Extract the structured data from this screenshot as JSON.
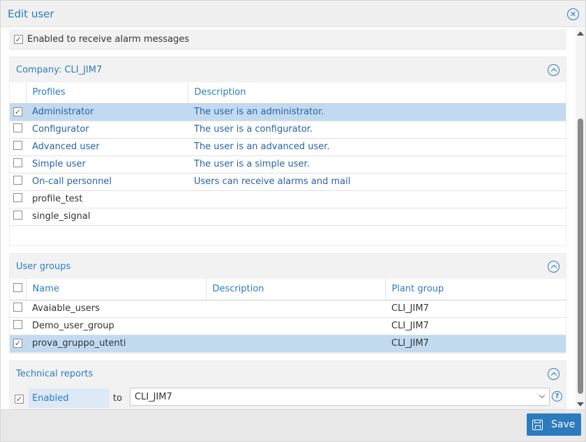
{
  "dialog": {
    "title": "Edit user",
    "save_label": "Save"
  },
  "alarm": {
    "label": "Enabled to receive alarm messages",
    "checked": true
  },
  "company": {
    "title": "Company: CLI_JIM7",
    "columns": [
      "Profiles",
      "Description"
    ],
    "rows": [
      {
        "name": "Administrator",
        "description": "The user is an administrator.",
        "checked": true
      },
      {
        "name": "Configurator",
        "description": "The user is a configurator.",
        "checked": false
      },
      {
        "name": "Advanced user",
        "description": "The user is an advanced user.",
        "checked": false
      },
      {
        "name": "Simple user",
        "description": "The user is a simple user.",
        "checked": false
      },
      {
        "name": "On-call personnel",
        "description": "Users can receive alarms and mail",
        "checked": false
      },
      {
        "name": "profile_test",
        "description": "",
        "checked": false
      },
      {
        "name": "single_signal",
        "description": "",
        "checked": false
      }
    ]
  },
  "user_groups": {
    "title": "User groups",
    "columns": [
      "Name",
      "Description",
      "Plant group"
    ],
    "rows": [
      {
        "name": "Avaiable_users",
        "description": "",
        "plant_group": "CLI_JIM7",
        "checked": false
      },
      {
        "name": "Demo_user_group",
        "description": "",
        "plant_group": "CLI_JIM7",
        "checked": false
      },
      {
        "name": "prova_gruppo_utenti",
        "description": "",
        "plant_group": "CLI_JIM7",
        "checked": true
      }
    ]
  },
  "technical_reports": {
    "title": "Technical reports",
    "enabled_label": "Enabled",
    "enabled_checked": true,
    "to_label": "to",
    "selected_value": "CLI_JIM7"
  },
  "icons": {
    "close": "close-circle-icon",
    "collapse": "chevron-up-circle-icon",
    "help": "question-circle-icon",
    "save": "floppy-disk-icon",
    "checked": "checkmark-icon"
  },
  "colors": {
    "accent": "#2d7bbf",
    "selected_row": "#c2daf0",
    "enabled_box": "#dde9f6"
  }
}
